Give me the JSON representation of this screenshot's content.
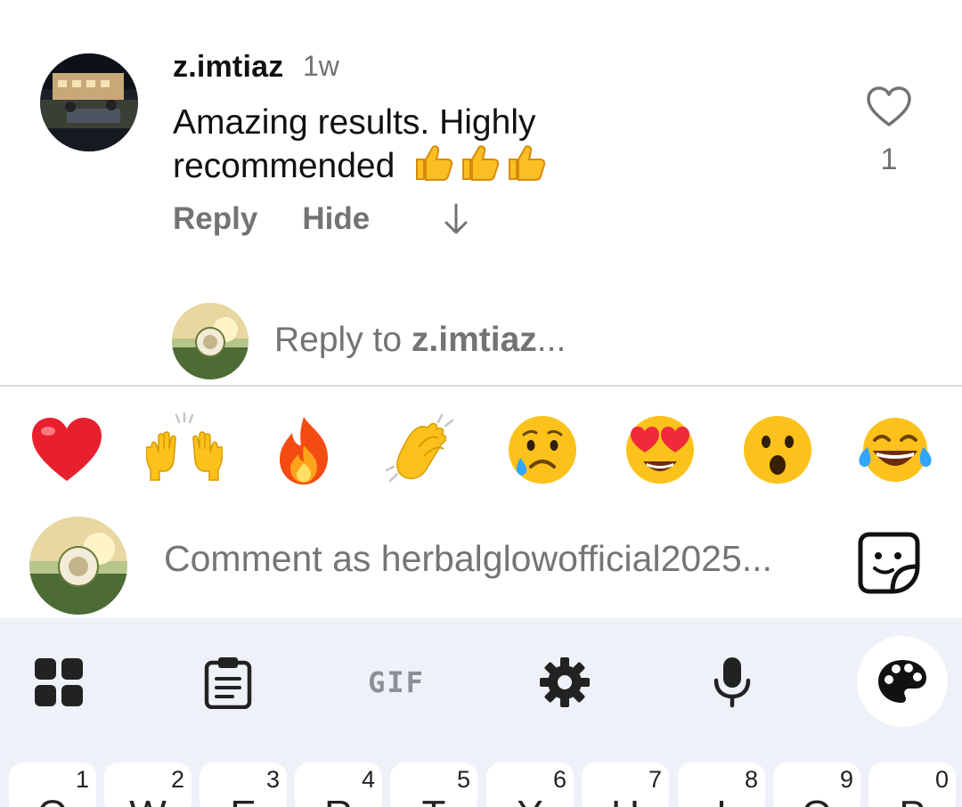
{
  "comment": {
    "username": "z.imtiaz",
    "time": "1w",
    "text": "Amazing results. Highly recommended",
    "thumbs_emoji": "thumbs-up x3",
    "actions": {
      "reply": "Reply",
      "hide": "Hide"
    },
    "like_count": "1"
  },
  "reply_box": {
    "prefix": "Reply to ",
    "target": "z.imtiaz",
    "ellipsis": "..."
  },
  "emoji_bar": [
    "red-heart",
    "raising-hands",
    "fire",
    "clapping-hands",
    "crying-face",
    "heart-eyes",
    "astonished-face",
    "tears-of-joy"
  ],
  "composer": {
    "placeholder": "Comment as herbalglowofficial2025..."
  },
  "keyboard": {
    "toolbar": [
      "apps-grid-icon",
      "clipboard-icon",
      "gif-button",
      "settings-gear-icon",
      "microphone-icon",
      "palette-icon"
    ],
    "gif_label": "GIF",
    "number_row": [
      "1",
      "2",
      "3",
      "4",
      "5",
      "6",
      "7",
      "8",
      "9",
      "0"
    ],
    "letter_row": [
      "Q",
      "W",
      "E",
      "R",
      "T",
      "Y",
      "U",
      "I",
      "O",
      "P"
    ]
  },
  "colors": {
    "text_primary": "#111111",
    "text_secondary": "#737373",
    "keyboard_bg": "#eef1f8",
    "divider": "#dbdbdb"
  }
}
